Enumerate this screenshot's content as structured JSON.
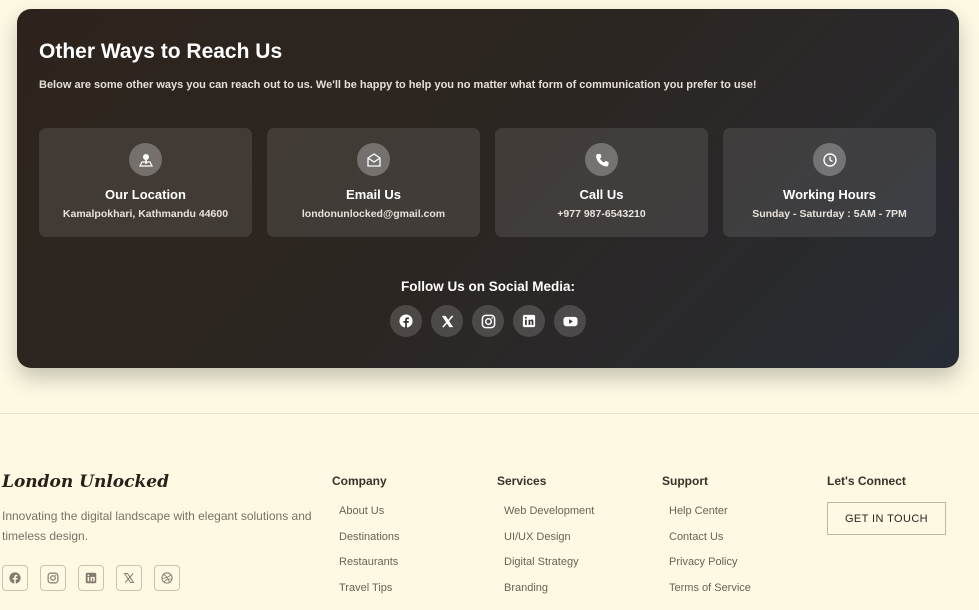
{
  "contact": {
    "title": "Other Ways to Reach Us",
    "subtitle": "Below are some other ways you can reach out to us. We'll be happy to help you no matter what form of communication you prefer to use!",
    "cards": [
      {
        "icon": "location-icon",
        "title": "Our Location",
        "text": "Kamalpokhari, Kathmandu 44600"
      },
      {
        "icon": "email-icon",
        "title": "Email Us",
        "text": "londonunlocked@gmail.com"
      },
      {
        "icon": "phone-icon",
        "title": "Call Us",
        "text": "+977 987-6543210"
      },
      {
        "icon": "clock-icon",
        "title": "Working Hours",
        "text": "Sunday - Saturday : 5AM - 7PM"
      }
    ],
    "follow_title": "Follow Us on Social Media:",
    "socials": [
      "facebook-icon",
      "x-icon",
      "instagram-icon",
      "linkedin-icon",
      "youtube-icon"
    ]
  },
  "footer": {
    "brand": "London Unlocked",
    "tagline": "Innovating the digital landscape with elegant solutions and timeless design.",
    "socials": [
      "facebook-icon",
      "instagram-icon",
      "linkedin-icon",
      "x-icon",
      "dribbble-icon"
    ],
    "columns": [
      {
        "heading": "Company",
        "links": [
          "About Us",
          "Destinations",
          "Restaurants",
          "Travel Tips"
        ]
      },
      {
        "heading": "Services",
        "links": [
          "Web Development",
          "UI/UX Design",
          "Digital Strategy",
          "Branding"
        ]
      },
      {
        "heading": "Support",
        "links": [
          "Help Center",
          "Contact Us",
          "Privacy Policy",
          "Terms of Service"
        ]
      }
    ],
    "connect_heading": "Let's Connect",
    "cta_label": "GET IN TOUCH"
  },
  "colors": {
    "page_bg": "#fdf9e3",
    "panel_dark": "#2c2622",
    "footer_text": "#6b6354"
  }
}
